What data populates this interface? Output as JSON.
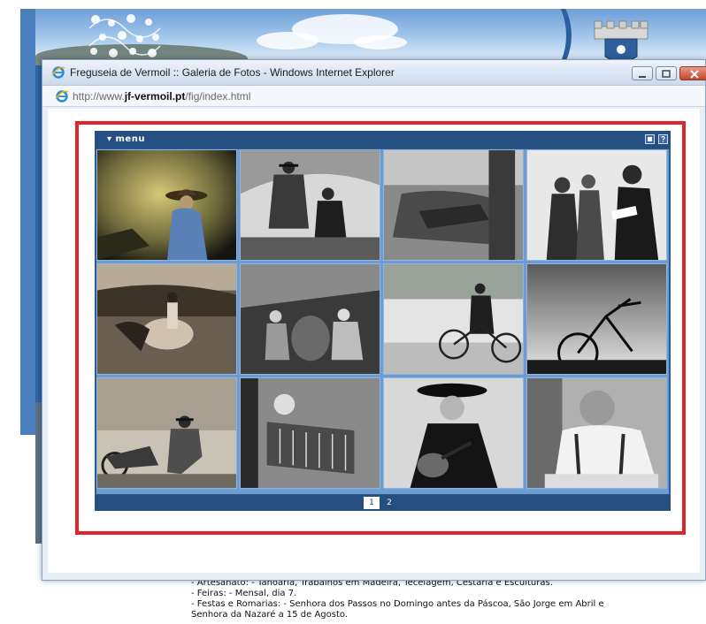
{
  "window": {
    "title": "Freguseia de Vermoil :: Galeria de Fotos - Windows Internet Explorer",
    "url_prefix": "http://www.",
    "url_domain": "jf-vermoil.pt",
    "url_path": "/fig/index.html"
  },
  "gallery": {
    "menu_label": "menu",
    "pages": [
      "1",
      "2"
    ],
    "current_page": "1",
    "photos": [
      {
        "name": "photo-woman-in-hat"
      },
      {
        "name": "photo-men-seated"
      },
      {
        "name": "photo-resting-figure"
      },
      {
        "name": "photo-dancers"
      },
      {
        "name": "photo-field-workers"
      },
      {
        "name": "photo-cooper-workshop"
      },
      {
        "name": "photo-man-with-bicycle"
      },
      {
        "name": "photo-bicycle-silhouette"
      },
      {
        "name": "photo-motorbike-repair"
      },
      {
        "name": "photo-accordion-player"
      },
      {
        "name": "photo-singer-with-guitar"
      },
      {
        "name": "photo-smiling-man"
      }
    ]
  },
  "page_text": {
    "line1": "- Artesanato: - Tanoaria, Trabalhos em Madeira, Tecelagem, Cestaria e Esculturas.",
    "line2": "- Feiras: - Mensal, dia 7.",
    "line3": "- Festas e Romarias: - Senhora dos Passos no Domingo antes da Páscoa, São Jorge em Abril e",
    "line4": "Senhora da Nazaré a 15 de Agosto."
  },
  "colors": {
    "highlight_frame": "#e0252a",
    "gallery_bar": "#244f80",
    "thumb_border": "#8fb6e2"
  }
}
